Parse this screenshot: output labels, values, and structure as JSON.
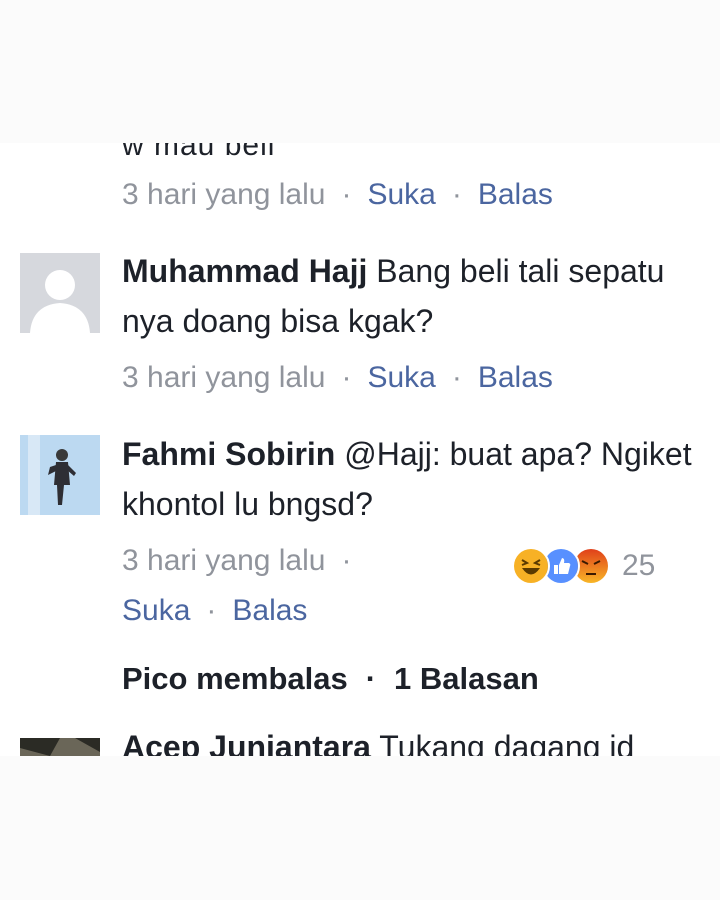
{
  "top_partial": {
    "text": "w mau beli",
    "time": "3 hari yang lalu",
    "like": "Suka",
    "reply": "Balas"
  },
  "comments": [
    {
      "author": "Muhammad Hajj",
      "text": "Bang beli tali sepatu nya doang bisa kgak?",
      "time": "3 hari yang lalu",
      "like": "Suka",
      "reply": "Balas",
      "avatar_icon": "default-profile-icon"
    },
    {
      "author": "Fahmi Sobirin",
      "text": "@Hajj: buat apa? Ngiket khontol lu bngsd?",
      "time": "3 hari yang lalu",
      "like": "Suka",
      "reply": "Balas",
      "reactions": [
        "haha-icon",
        "like-icon",
        "angry-icon"
      ],
      "reaction_count": "25",
      "replies_author_text": "Pico membalas",
      "replies_count_text": "1 Balasan",
      "avatar_icon": "user-photo-icon"
    },
    {
      "author": "Acep Juniantara",
      "text": "Tukang dagang id",
      "avatar_icon": "user-photo-icon"
    }
  ],
  "separator": "·",
  "colors": {
    "link": "#4b66a0",
    "meta": "#90949c",
    "text": "#1d2129",
    "haha": "#f7b125",
    "like": "#5890ff",
    "angry": "#e9710f"
  }
}
